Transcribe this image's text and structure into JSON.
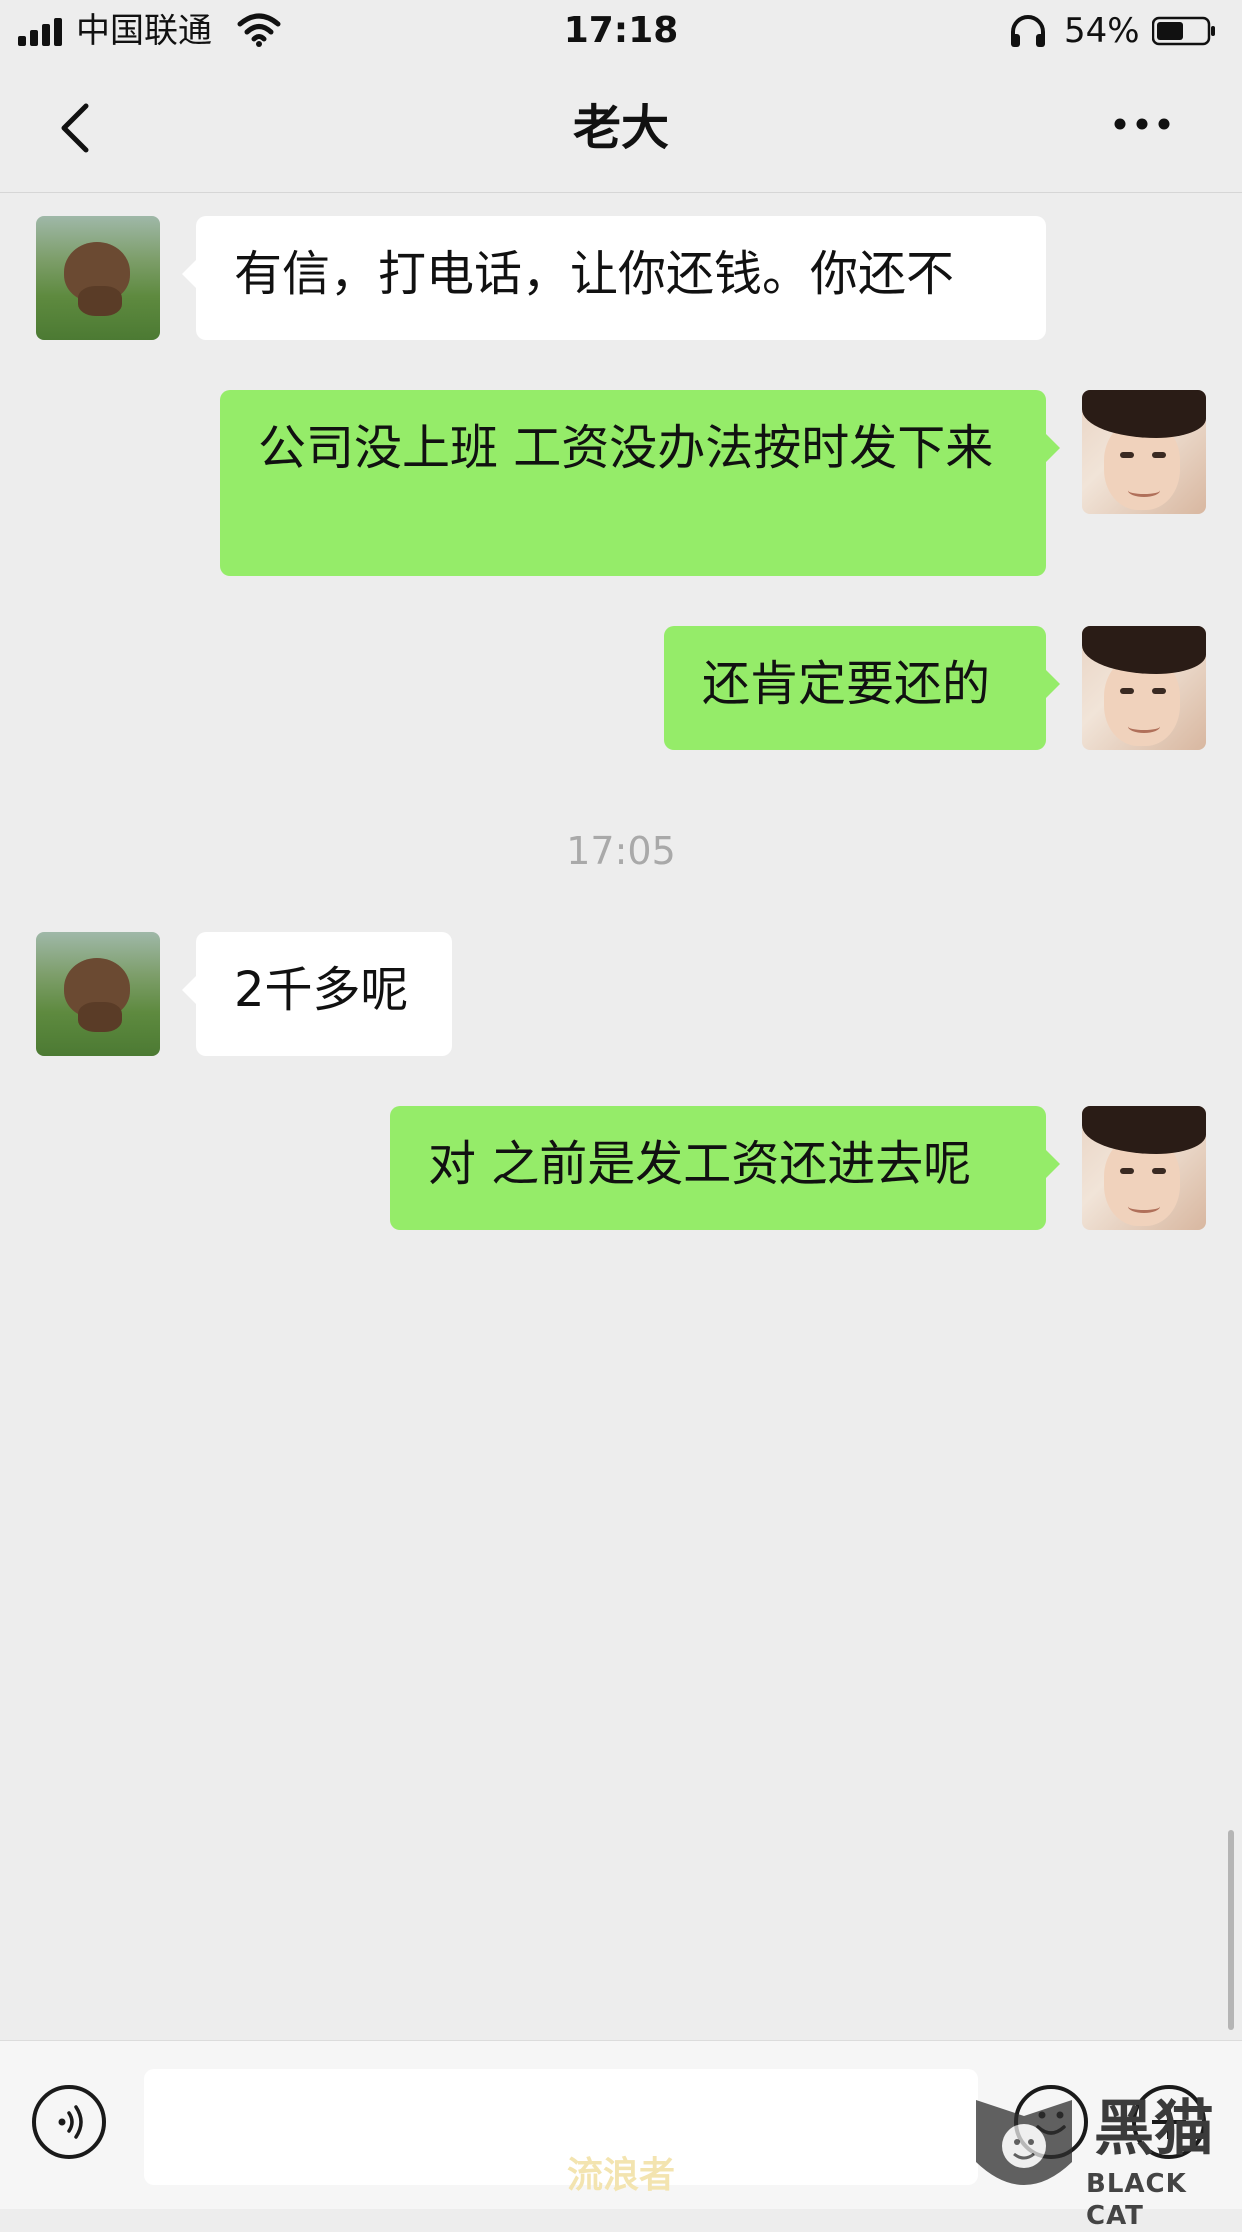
{
  "status_bar": {
    "carrier": "中国联通",
    "time": "17:18",
    "battery_percent": "54%",
    "battery_level": 0.54
  },
  "nav": {
    "title": "老大",
    "back_icon": "chevron-left-icon",
    "more_icon": "more-horizontal-icon"
  },
  "messages": [
    {
      "side": "in",
      "text": "有信，打电话，让你还钱。你还不"
    },
    {
      "side": "out",
      "text": "公司没上班  工资没办法按时发下来"
    },
    {
      "side": "out",
      "text": "还肯定要还的"
    },
    {
      "side": "in",
      "text": "2千多呢"
    },
    {
      "side": "out",
      "text": "对 之前是发工资还进去呢"
    }
  ],
  "timestamp": "17:05",
  "input_bar": {
    "voice_icon": "voice-icon",
    "emoji_icon": "emoji-icon",
    "plus_icon": "plus-icon",
    "value": ""
  },
  "watermark": {
    "center": "流浪者",
    "logo_char": "黑猫",
    "logo_caption": "BLACK CAT"
  },
  "colors": {
    "background": "#ededed",
    "outgoing_bubble": "#95ec69",
    "incoming_bubble": "#ffffff"
  }
}
